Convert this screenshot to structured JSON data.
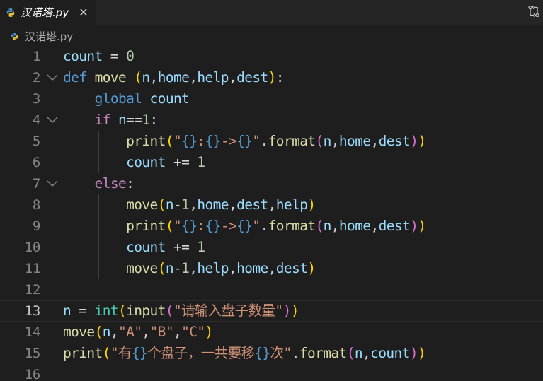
{
  "tab": {
    "title": "汉诺塔.py",
    "close_label": "✕",
    "icon": "python-icon"
  },
  "toolbar": {
    "compare_icon": "compare-changes-icon"
  },
  "breadcrumb": {
    "file": "汉诺塔.py",
    "icon": "python-icon"
  },
  "editor": {
    "current_line": 13,
    "lines": [
      {
        "n": "1",
        "fold": false,
        "tokens": [
          [
            "var",
            "count"
          ],
          [
            "op",
            " = "
          ],
          [
            "num",
            "0"
          ]
        ]
      },
      {
        "n": "2",
        "fold": true,
        "tokens": [
          [
            "kw",
            "def"
          ],
          [
            "op",
            " "
          ],
          [
            "fn",
            "move"
          ],
          [
            "op",
            " "
          ],
          [
            "b1",
            "("
          ],
          [
            "var",
            "n"
          ],
          [
            "op",
            ","
          ],
          [
            "var",
            "home"
          ],
          [
            "op",
            ","
          ],
          [
            "var",
            "help"
          ],
          [
            "op",
            ","
          ],
          [
            "var",
            "dest"
          ],
          [
            "b1",
            ")"
          ],
          [
            "op",
            ":"
          ]
        ]
      },
      {
        "n": "3",
        "fold": false,
        "tokens": [
          [
            "op",
            "    "
          ],
          [
            "kw",
            "global"
          ],
          [
            "op",
            " "
          ],
          [
            "var",
            "count"
          ]
        ]
      },
      {
        "n": "4",
        "fold": true,
        "tokens": [
          [
            "op",
            "    "
          ],
          [
            "ctl",
            "if"
          ],
          [
            "op",
            " "
          ],
          [
            "var",
            "n"
          ],
          [
            "op",
            "=="
          ],
          [
            "num",
            "1"
          ],
          [
            "op",
            ":"
          ]
        ]
      },
      {
        "n": "5",
        "fold": false,
        "tokens": [
          [
            "op",
            "        "
          ],
          [
            "fn",
            "print"
          ],
          [
            "b1",
            "("
          ],
          [
            "str",
            "\""
          ],
          [
            "esc",
            "{}"
          ],
          [
            "str",
            ":"
          ],
          [
            "esc",
            "{}"
          ],
          [
            "str",
            "->"
          ],
          [
            "esc",
            "{}"
          ],
          [
            "str",
            "\""
          ],
          [
            "op",
            "."
          ],
          [
            "fn",
            "format"
          ],
          [
            "b2",
            "("
          ],
          [
            "var",
            "n"
          ],
          [
            "op",
            ","
          ],
          [
            "var",
            "home"
          ],
          [
            "op",
            ","
          ],
          [
            "var",
            "dest"
          ],
          [
            "b2",
            ")"
          ],
          [
            "b1",
            ")"
          ]
        ]
      },
      {
        "n": "6",
        "fold": false,
        "tokens": [
          [
            "op",
            "        "
          ],
          [
            "var",
            "count"
          ],
          [
            "op",
            " += "
          ],
          [
            "num",
            "1"
          ]
        ]
      },
      {
        "n": "7",
        "fold": true,
        "tokens": [
          [
            "op",
            "    "
          ],
          [
            "ctl",
            "else"
          ],
          [
            "op",
            ":"
          ]
        ]
      },
      {
        "n": "8",
        "fold": false,
        "tokens": [
          [
            "op",
            "        "
          ],
          [
            "fn",
            "move"
          ],
          [
            "b1",
            "("
          ],
          [
            "var",
            "n"
          ],
          [
            "op",
            "-"
          ],
          [
            "num",
            "1"
          ],
          [
            "op",
            ","
          ],
          [
            "var",
            "home"
          ],
          [
            "op",
            ","
          ],
          [
            "var",
            "dest"
          ],
          [
            "op",
            ","
          ],
          [
            "var",
            "help"
          ],
          [
            "b1",
            ")"
          ]
        ]
      },
      {
        "n": "9",
        "fold": false,
        "tokens": [
          [
            "op",
            "        "
          ],
          [
            "fn",
            "print"
          ],
          [
            "b1",
            "("
          ],
          [
            "str",
            "\""
          ],
          [
            "esc",
            "{}"
          ],
          [
            "str",
            ":"
          ],
          [
            "esc",
            "{}"
          ],
          [
            "str",
            "->"
          ],
          [
            "esc",
            "{}"
          ],
          [
            "str",
            "\""
          ],
          [
            "op",
            "."
          ],
          [
            "fn",
            "format"
          ],
          [
            "b2",
            "("
          ],
          [
            "var",
            "n"
          ],
          [
            "op",
            ","
          ],
          [
            "var",
            "home"
          ],
          [
            "op",
            ","
          ],
          [
            "var",
            "dest"
          ],
          [
            "b2",
            ")"
          ],
          [
            "b1",
            ")"
          ]
        ]
      },
      {
        "n": "10",
        "fold": false,
        "tokens": [
          [
            "op",
            "        "
          ],
          [
            "var",
            "count"
          ],
          [
            "op",
            " += "
          ],
          [
            "num",
            "1"
          ]
        ]
      },
      {
        "n": "11",
        "fold": false,
        "tokens": [
          [
            "op",
            "        "
          ],
          [
            "fn",
            "move"
          ],
          [
            "b1",
            "("
          ],
          [
            "var",
            "n"
          ],
          [
            "op",
            "-"
          ],
          [
            "num",
            "1"
          ],
          [
            "op",
            ","
          ],
          [
            "var",
            "help"
          ],
          [
            "op",
            ","
          ],
          [
            "var",
            "home"
          ],
          [
            "op",
            ","
          ],
          [
            "var",
            "dest"
          ],
          [
            "b1",
            ")"
          ]
        ]
      },
      {
        "n": "12",
        "fold": false,
        "tokens": []
      },
      {
        "n": "13",
        "fold": false,
        "tokens": [
          [
            "var",
            "n"
          ],
          [
            "op",
            " = "
          ],
          [
            "cls",
            "int"
          ],
          [
            "b1",
            "("
          ],
          [
            "fn",
            "input"
          ],
          [
            "b2",
            "("
          ],
          [
            "str",
            "\"请输入盘子数量\""
          ],
          [
            "b2",
            ")"
          ],
          [
            "b1",
            ")"
          ]
        ]
      },
      {
        "n": "14",
        "fold": false,
        "tokens": [
          [
            "fn",
            "move"
          ],
          [
            "b1",
            "("
          ],
          [
            "var",
            "n"
          ],
          [
            "op",
            ","
          ],
          [
            "str",
            "\"A\""
          ],
          [
            "op",
            ","
          ],
          [
            "str",
            "\"B\""
          ],
          [
            "op",
            ","
          ],
          [
            "str",
            "\"C\""
          ],
          [
            "b1",
            ")"
          ]
        ]
      },
      {
        "n": "15",
        "fold": false,
        "tokens": [
          [
            "fn",
            "print"
          ],
          [
            "b1",
            "("
          ],
          [
            "str",
            "\"有"
          ],
          [
            "esc",
            "{}"
          ],
          [
            "str",
            "个盘子，一共要移"
          ],
          [
            "esc",
            "{}"
          ],
          [
            "str",
            "次\""
          ],
          [
            "op",
            "."
          ],
          [
            "fn",
            "format"
          ],
          [
            "b2",
            "("
          ],
          [
            "var",
            "n"
          ],
          [
            "op",
            ","
          ],
          [
            "var",
            "count"
          ],
          [
            "b2",
            ")"
          ],
          [
            "b1",
            ")"
          ]
        ]
      },
      {
        "n": "16",
        "fold": false,
        "tokens": []
      }
    ]
  },
  "colors": {
    "background": "#1e1e1e",
    "tabbar": "#252526",
    "keyword": "#569cd6",
    "control": "#c586c0",
    "function": "#dcdcaa",
    "variable": "#9cdcfe",
    "number": "#b5cea8",
    "string": "#ce9178",
    "bracket_level1": "#ffd700",
    "bracket_level2": "#da70d6"
  }
}
